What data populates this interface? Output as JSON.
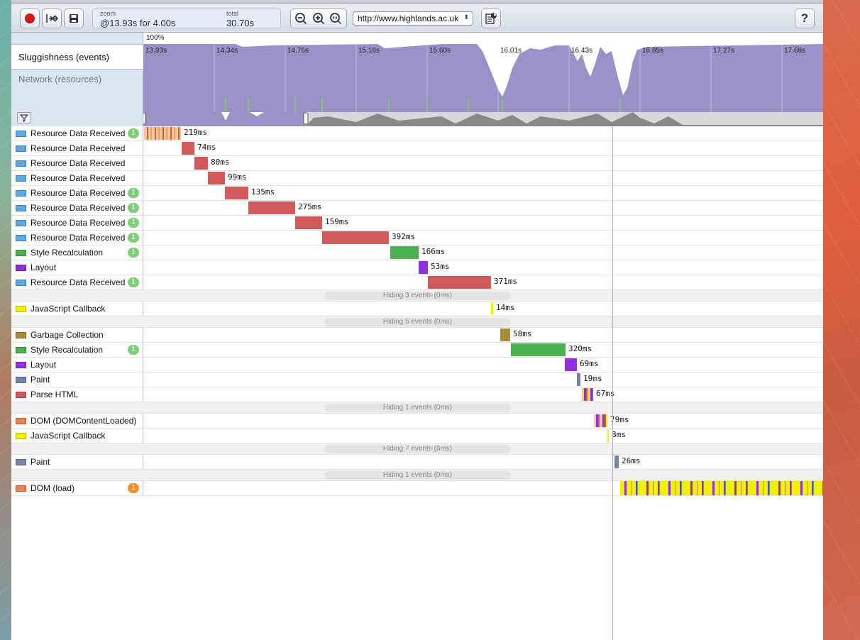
{
  "toolbar": {
    "record_label": "",
    "zoom": {
      "label": "zoom",
      "value": "@13.93s for 4.00s"
    },
    "total": {
      "label": "total",
      "value": "30.70s"
    },
    "url": "http://www.highlands.ac.uk",
    "help_label": "?"
  },
  "overview": {
    "zoom_percent": "100%",
    "tab_events": "Sluggishness (events)",
    "tab_resources": "Network (resources)",
    "ticks": [
      "13.93s",
      "14.34s",
      "14.76s",
      "15.18s",
      "15.60s",
      "16.01s",
      "16.43s",
      "16.85s",
      "17.27s",
      "17.68s"
    ],
    "area_color": "#9a92c6"
  },
  "colors": {
    "resource_swatch": "#5aa9e6",
    "resource_bar": "#d05a5a",
    "style_green": "#4caf50",
    "layout_purple": "#9030e0",
    "js_yellow": "#f2f200",
    "gc_olive": "#a9893a",
    "paint_slate": "#7684a8",
    "parse_html": "#d05a5a",
    "dom_orange": "#ee7f4e",
    "badge_green": "#7fcf7a",
    "badge_orange": "#f0922e"
  },
  "rows": [
    {
      "label": "Resource Data Received",
      "badge": "1",
      "duration": "219ms"
    },
    {
      "label": "Resource Data Received",
      "badge": "",
      "duration": "74ms"
    },
    {
      "label": "Resource Data Received",
      "badge": "",
      "duration": "80ms"
    },
    {
      "label": "Resource Data Received",
      "badge": "",
      "duration": "99ms"
    },
    {
      "label": "Resource Data Received",
      "badge": "1",
      "duration": "135ms"
    },
    {
      "label": "Resource Data Received",
      "badge": "1",
      "duration": "275ms"
    },
    {
      "label": "Resource Data Received",
      "badge": "1",
      "duration": "159ms"
    },
    {
      "label": "Resource Data Received",
      "badge": "1",
      "duration": "392ms"
    },
    {
      "label": "Style Recalculation",
      "badge": "1",
      "duration": "166ms"
    },
    {
      "label": "Layout",
      "badge": "",
      "duration": "53ms"
    },
    {
      "label": "Resource Data Received",
      "badge": "1",
      "duration": "371ms"
    },
    {
      "hidden": "Hiding 3 events (0ms)"
    },
    {
      "label": "JavaScript Callback",
      "badge": "",
      "duration": "14ms"
    },
    {
      "hidden": "Hiding 5 events (0ms)"
    },
    {
      "label": "Garbage Collection",
      "badge": "",
      "duration": "58ms"
    },
    {
      "label": "Style Recalculation",
      "badge": "1",
      "duration": "320ms"
    },
    {
      "label": "Layout",
      "badge": "",
      "duration": "69ms"
    },
    {
      "label": "Paint",
      "badge": "",
      "duration": "19ms"
    },
    {
      "label": "Parse HTML",
      "badge": "",
      "duration": "67ms"
    },
    {
      "hidden": "Hiding 1 events (0ms)"
    },
    {
      "label": "DOM (DOMContentLoaded)",
      "badge": "",
      "duration": "79ms"
    },
    {
      "label": "JavaScript Callback",
      "badge": "",
      "duration": "8ms"
    },
    {
      "hidden": "Hiding 7 events (8ms)"
    },
    {
      "label": "Paint",
      "badge": "",
      "duration": "26ms"
    },
    {
      "hidden": "Hiding 1 events (0ms)"
    },
    {
      "label": "DOM (load)",
      "badge": "1",
      "duration": ""
    }
  ]
}
